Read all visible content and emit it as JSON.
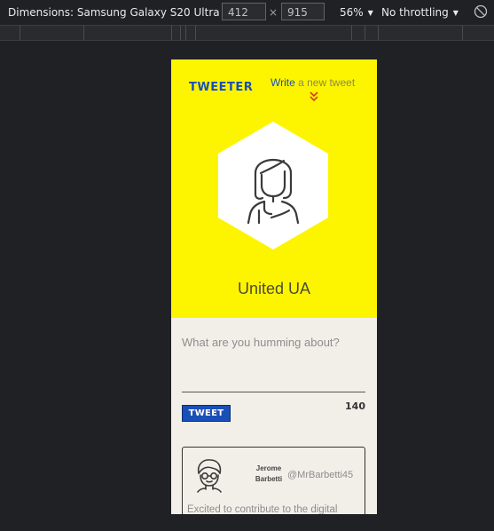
{
  "devtools": {
    "dimensions_label": "Dimensions: Samsung Galaxy S20 Ultra",
    "width_value": "412",
    "times_sign": "×",
    "height_value": "915",
    "zoom_label": "56%",
    "throttling_label": "No throttling"
  },
  "header": {
    "logo_text": "TWEETER",
    "write_link_word": "Write",
    "write_link_rest": " a new tweet"
  },
  "profile": {
    "location": "United UA"
  },
  "compose": {
    "placeholder": "What are you humming about?",
    "button_label": "TWEET",
    "char_count": "140"
  },
  "tweets": [
    {
      "name_line1": "Jerome",
      "name_line2": "Barbetti",
      "handle": "@MrBarbetti45",
      "text": "Excited to contribute to the digital"
    }
  ],
  "colors": {
    "hero_yellow": "#fdf500",
    "brand_blue": "#1a4fb8",
    "page_beige": "#f2efe9",
    "devtools_bg": "#202124"
  }
}
